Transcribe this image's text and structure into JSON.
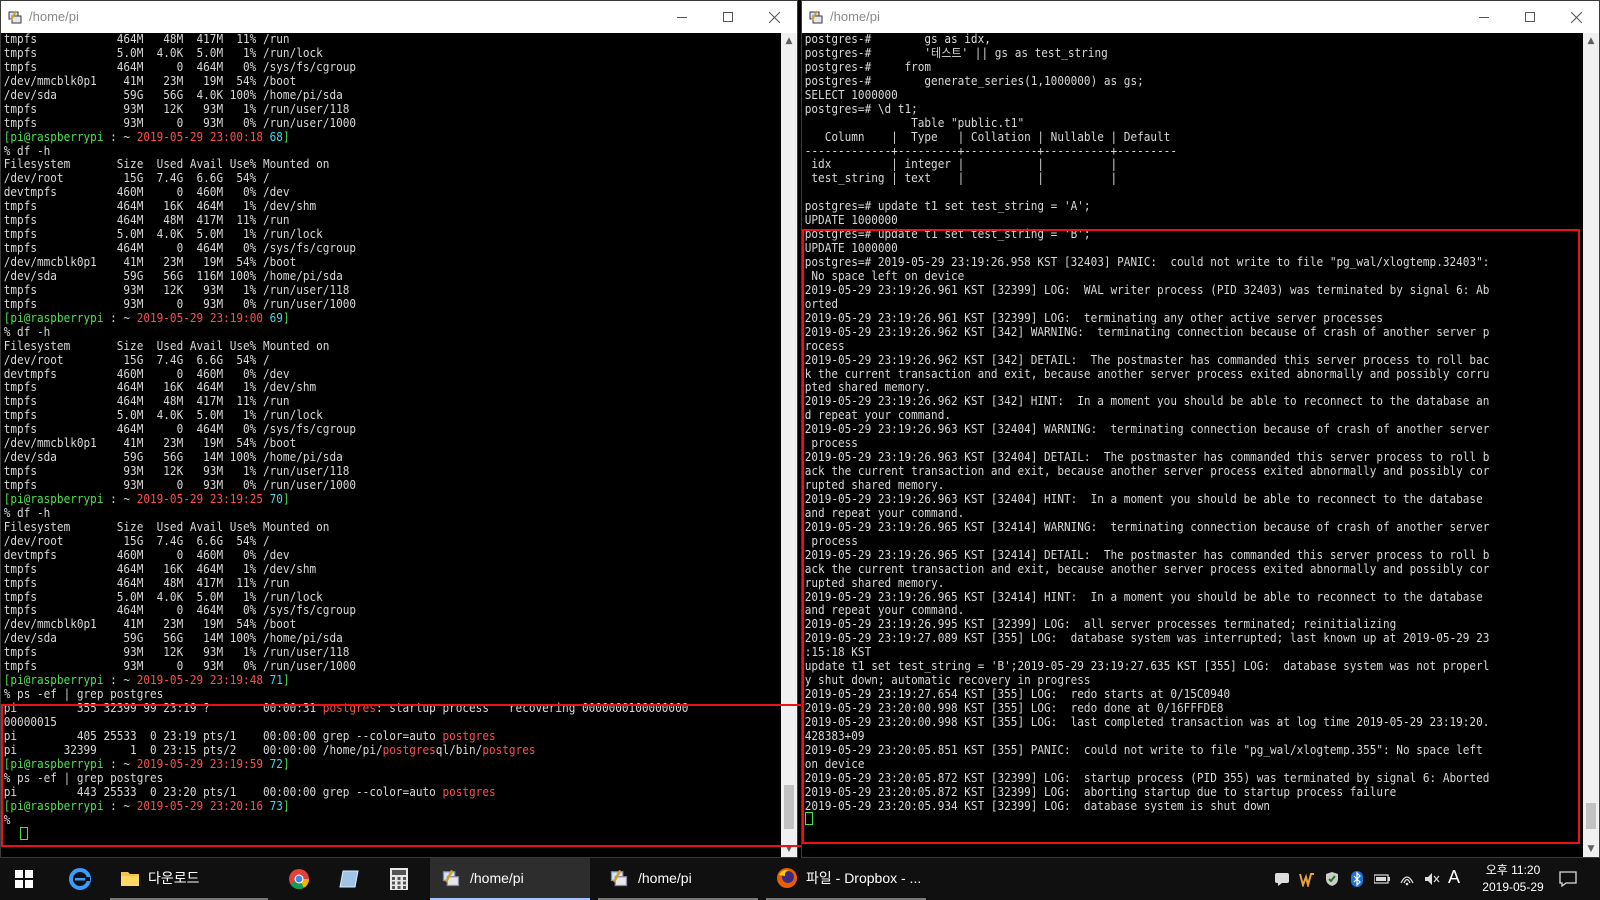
{
  "left_window": {
    "title": "/home/pi",
    "lines": [
      [
        {
          "t": "tmpfs            464M   48M  417M  11% /run"
        }
      ],
      [
        {
          "t": "tmpfs            5.0M  4.0K  5.0M   1% /run/lock"
        }
      ],
      [
        {
          "t": "tmpfs            464M     0  464M   0% /sys/fs/cgroup"
        }
      ],
      [
        {
          "t": "/dev/mmcblk0p1    41M   23M   19M  54% /boot"
        }
      ],
      [
        {
          "t": "/dev/sda          59G   56G  4.0K 100% /home/pi/sda"
        }
      ],
      [
        {
          "t": "tmpfs             93M   12K   93M   1% /run/user/118"
        }
      ],
      [
        {
          "t": "tmpfs             93M     0   93M   0% /run/user/1000"
        }
      ],
      [
        {
          "t": "[pi@raspberrypi",
          "c": "green"
        },
        {
          "t": " : ~ "
        },
        {
          "t": "2019-05-29 23:00:18",
          "c": "red"
        },
        {
          "t": " "
        },
        {
          "t": "68",
          "c": "cyan"
        },
        {
          "t": "]",
          "c": "green"
        }
      ],
      [
        {
          "t": "% df -h"
        }
      ],
      [
        {
          "t": "Filesystem       Size  Used Avail Use% Mounted on"
        }
      ],
      [
        {
          "t": "/dev/root         15G  7.4G  6.6G  54% /"
        }
      ],
      [
        {
          "t": "devtmpfs         460M     0  460M   0% /dev"
        }
      ],
      [
        {
          "t": "tmpfs            464M   16K  464M   1% /dev/shm"
        }
      ],
      [
        {
          "t": "tmpfs            464M   48M  417M  11% /run"
        }
      ],
      [
        {
          "t": "tmpfs            5.0M  4.0K  5.0M   1% /run/lock"
        }
      ],
      [
        {
          "t": "tmpfs            464M     0  464M   0% /sys/fs/cgroup"
        }
      ],
      [
        {
          "t": "/dev/mmcblk0p1    41M   23M   19M  54% /boot"
        }
      ],
      [
        {
          "t": "/dev/sda          59G   56G  116M 100% /home/pi/sda"
        }
      ],
      [
        {
          "t": "tmpfs             93M   12K   93M   1% /run/user/118"
        }
      ],
      [
        {
          "t": "tmpfs             93M     0   93M   0% /run/user/1000"
        }
      ],
      [
        {
          "t": "[pi@raspberrypi",
          "c": "green"
        },
        {
          "t": " : ~ "
        },
        {
          "t": "2019-05-29 23:19:00",
          "c": "red"
        },
        {
          "t": " "
        },
        {
          "t": "69",
          "c": "cyan"
        },
        {
          "t": "]",
          "c": "green"
        }
      ],
      [
        {
          "t": "% df -h"
        }
      ],
      [
        {
          "t": "Filesystem       Size  Used Avail Use% Mounted on"
        }
      ],
      [
        {
          "t": "/dev/root         15G  7.4G  6.6G  54% /"
        }
      ],
      [
        {
          "t": "devtmpfs         460M     0  460M   0% /dev"
        }
      ],
      [
        {
          "t": "tmpfs            464M   16K  464M   1% /dev/shm"
        }
      ],
      [
        {
          "t": "tmpfs            464M   48M  417M  11% /run"
        }
      ],
      [
        {
          "t": "tmpfs            5.0M  4.0K  5.0M   1% /run/lock"
        }
      ],
      [
        {
          "t": "tmpfs            464M     0  464M   0% /sys/fs/cgroup"
        }
      ],
      [
        {
          "t": "/dev/mmcblk0p1    41M   23M   19M  54% /boot"
        }
      ],
      [
        {
          "t": "/dev/sda          59G   56G   14M 100% /home/pi/sda"
        }
      ],
      [
        {
          "t": "tmpfs             93M   12K   93M   1% /run/user/118"
        }
      ],
      [
        {
          "t": "tmpfs             93M     0   93M   0% /run/user/1000"
        }
      ],
      [
        {
          "t": "[pi@raspberrypi",
          "c": "green"
        },
        {
          "t": " : ~ "
        },
        {
          "t": "2019-05-29 23:19:25",
          "c": "red"
        },
        {
          "t": " "
        },
        {
          "t": "70",
          "c": "cyan"
        },
        {
          "t": "]",
          "c": "green"
        }
      ],
      [
        {
          "t": "% df -h"
        }
      ],
      [
        {
          "t": "Filesystem       Size  Used Avail Use% Mounted on"
        }
      ],
      [
        {
          "t": "/dev/root         15G  7.4G  6.6G  54% /"
        }
      ],
      [
        {
          "t": "devtmpfs         460M     0  460M   0% /dev"
        }
      ],
      [
        {
          "t": "tmpfs            464M   16K  464M   1% /dev/shm"
        }
      ],
      [
        {
          "t": "tmpfs            464M   48M  417M  11% /run"
        }
      ],
      [
        {
          "t": "tmpfs            5.0M  4.0K  5.0M   1% /run/lock"
        }
      ],
      [
        {
          "t": "tmpfs            464M     0  464M   0% /sys/fs/cgroup"
        }
      ],
      [
        {
          "t": "/dev/mmcblk0p1    41M   23M   19M  54% /boot"
        }
      ],
      [
        {
          "t": "/dev/sda          59G   56G   14M 100% /home/pi/sda"
        }
      ],
      [
        {
          "t": "tmpfs             93M   12K   93M   1% /run/user/118"
        }
      ],
      [
        {
          "t": "tmpfs             93M     0   93M   0% /run/user/1000"
        }
      ],
      [
        {
          "t": "[pi@raspberrypi",
          "c": "green"
        },
        {
          "t": " : ~ "
        },
        {
          "t": "2019-05-29 23:19:48",
          "c": "red"
        },
        {
          "t": " "
        },
        {
          "t": "71",
          "c": "cyan"
        },
        {
          "t": "]",
          "c": "green"
        }
      ],
      [
        {
          "t": "% ps -ef | grep postgres"
        }
      ],
      [
        {
          "t": "pi         355 32399 99 23:19 ?        00:00:31 "
        },
        {
          "t": "postgres",
          "c": "red"
        },
        {
          "t": ": startup process   recovering 0000000100000000"
        }
      ],
      [
        {
          "t": "00000015"
        }
      ],
      [
        {
          "t": "pi         405 25533  0 23:19 pts/1    00:00:00 grep --color=auto "
        },
        {
          "t": "postgres",
          "c": "red"
        }
      ],
      [
        {
          "t": "pi       32399     1  0 23:15 pts/2    00:00:00 /home/pi/"
        },
        {
          "t": "postgres",
          "c": "red"
        },
        {
          "t": "ql/bin/"
        },
        {
          "t": "postgres",
          "c": "red"
        }
      ],
      [
        {
          "t": "[pi@raspberrypi",
          "c": "green"
        },
        {
          "t": " : ~ "
        },
        {
          "t": "2019-05-29 23:19:59",
          "c": "red"
        },
        {
          "t": " "
        },
        {
          "t": "72",
          "c": "cyan"
        },
        {
          "t": "]",
          "c": "green"
        }
      ],
      [
        {
          "t": "% ps -ef | grep postgres"
        }
      ],
      [
        {
          "t": "pi         443 25533  0 23:20 pts/1    00:00:00 grep --color=auto "
        },
        {
          "t": "postgres",
          "c": "red"
        }
      ],
      [
        {
          "t": "[pi@raspberrypi",
          "c": "green"
        },
        {
          "t": " : ~ "
        },
        {
          "t": "2019-05-29 23:20:16",
          "c": "red"
        },
        {
          "t": " "
        },
        {
          "t": "73",
          "c": "cyan"
        },
        {
          "t": "]",
          "c": "green"
        }
      ],
      [
        {
          "t": "% "
        }
      ]
    ]
  },
  "right_window": {
    "title": "/home/pi",
    "lines": [
      [
        {
          "t": "postgres-#        gs as idx,"
        }
      ],
      [
        {
          "t": "postgres-#        '테스트' || gs as test_string"
        }
      ],
      [
        {
          "t": "postgres-#     from"
        }
      ],
      [
        {
          "t": "postgres-#        generate_series(1,1000000) as gs;"
        }
      ],
      [
        {
          "t": "SELECT 1000000"
        }
      ],
      [
        {
          "t": "postgres=# \\d t1;"
        }
      ],
      [
        {
          "t": "                Table \"public.t1\""
        }
      ],
      [
        {
          "t": "   Column    |  Type   | Collation | Nullable | Default"
        }
      ],
      [
        {
          "t": "-------------+---------+-----------+----------+---------"
        }
      ],
      [
        {
          "t": " idx         | integer |           |          |"
        }
      ],
      [
        {
          "t": " test_string | text    |           |          |"
        }
      ],
      [
        {
          "t": ""
        }
      ],
      [
        {
          "t": "postgres=# update t1 set test_string = 'A';"
        }
      ],
      [
        {
          "t": "UPDATE 1000000"
        }
      ],
      [
        {
          "t": "postgres=# update t1 set test_string = 'B';"
        }
      ],
      [
        {
          "t": "UPDATE 1000000"
        }
      ],
      [
        {
          "t": "postgres=# 2019-05-29 23:19:26.958 KST [32403] PANIC:  could not write to file \"pg_wal/xlogtemp.32403\":"
        }
      ],
      [
        {
          "t": " No space left on device"
        }
      ],
      [
        {
          "t": "2019-05-29 23:19:26.961 KST [32399] LOG:  WAL writer process (PID 32403) was terminated by signal 6: Ab"
        }
      ],
      [
        {
          "t": "orted"
        }
      ],
      [
        {
          "t": "2019-05-29 23:19:26.961 KST [32399] LOG:  terminating any other active server processes"
        }
      ],
      [
        {
          "t": "2019-05-29 23:19:26.962 KST [342] WARNING:  terminating connection because of crash of another server p"
        }
      ],
      [
        {
          "t": "rocess"
        }
      ],
      [
        {
          "t": "2019-05-29 23:19:26.962 KST [342] DETAIL:  The postmaster has commanded this server process to roll bac"
        }
      ],
      [
        {
          "t": "k the current transaction and exit, because another server process exited abnormally and possibly corru"
        }
      ],
      [
        {
          "t": "pted shared memory."
        }
      ],
      [
        {
          "t": "2019-05-29 23:19:26.962 KST [342] HINT:  In a moment you should be able to reconnect to the database an"
        }
      ],
      [
        {
          "t": "d repeat your command."
        }
      ],
      [
        {
          "t": "2019-05-29 23:19:26.963 KST [32404] WARNING:  terminating connection because of crash of another server"
        }
      ],
      [
        {
          "t": " process"
        }
      ],
      [
        {
          "t": "2019-05-29 23:19:26.963 KST [32404] DETAIL:  The postmaster has commanded this server process to roll b"
        }
      ],
      [
        {
          "t": "ack the current transaction and exit, because another server process exited abnormally and possibly cor"
        }
      ],
      [
        {
          "t": "rupted shared memory."
        }
      ],
      [
        {
          "t": "2019-05-29 23:19:26.963 KST [32404] HINT:  In a moment you should be able to reconnect to the database"
        }
      ],
      [
        {
          "t": "and repeat your command."
        }
      ],
      [
        {
          "t": "2019-05-29 23:19:26.965 KST [32414] WARNING:  terminating connection because of crash of another server"
        }
      ],
      [
        {
          "t": " process"
        }
      ],
      [
        {
          "t": "2019-05-29 23:19:26.965 KST [32414] DETAIL:  The postmaster has commanded this server process to roll b"
        }
      ],
      [
        {
          "t": "ack the current transaction and exit, because another server process exited abnormally and possibly cor"
        }
      ],
      [
        {
          "t": "rupted shared memory."
        }
      ],
      [
        {
          "t": "2019-05-29 23:19:26.965 KST [32414] HINT:  In a moment you should be able to reconnect to the database"
        }
      ],
      [
        {
          "t": "and repeat your command."
        }
      ],
      [
        {
          "t": "2019-05-29 23:19:26.995 KST [32399] LOG:  all server processes terminated; reinitializing"
        }
      ],
      [
        {
          "t": "2019-05-29 23:19:27.089 KST [355] LOG:  database system was interrupted; last known up at 2019-05-29 23"
        }
      ],
      [
        {
          "t": ":15:18 KST"
        }
      ],
      [
        {
          "t": "update t1 set test_string = 'B';2019-05-29 23:19:27.635 KST [355] LOG:  database system was not properl"
        }
      ],
      [
        {
          "t": "y shut down; automatic recovery in progress"
        }
      ],
      [
        {
          "t": "2019-05-29 23:19:27.654 KST [355] LOG:  redo starts at 0/15C0940"
        }
      ],
      [
        {
          "t": "2019-05-29 23:20:00.998 KST [355] LOG:  redo done at 0/16FFFDE8"
        }
      ],
      [
        {
          "t": "2019-05-29 23:20:00.998 KST [355] LOG:  last completed transaction was at log time 2019-05-29 23:19:20."
        }
      ],
      [
        {
          "t": "428383+09"
        }
      ],
      [
        {
          "t": "2019-05-29 23:20:05.851 KST [355] PANIC:  could not write to file \"pg_wal/xlogtemp.355\": No space left"
        }
      ],
      [
        {
          "t": "on device"
        }
      ],
      [
        {
          "t": "2019-05-29 23:20:05.872 KST [32399] LOG:  startup process (PID 355) was terminated by signal 6: Aborted"
        }
      ],
      [
        {
          "t": "2019-05-29 23:20:05.872 KST [32399] LOG:  aborting startup due to startup process failure"
        }
      ],
      [
        {
          "t": "2019-05-29 23:20:05.934 KST [32399] LOG:  database system is shut down"
        }
      ],
      [
        {
          "t": ""
        }
      ]
    ]
  },
  "taskbar": {
    "items": [
      {
        "name": "taskbar-file-explorer",
        "label": "다운로드",
        "icon": "folder-icon"
      },
      {
        "name": "taskbar-terminal-1",
        "label": "/home/pi",
        "icon": "terminal-icon"
      },
      {
        "name": "taskbar-terminal-2",
        "label": "/home/pi",
        "icon": "terminal-icon"
      },
      {
        "name": "taskbar-firefox",
        "label": "파일 - Dropbox - ...",
        "icon": "firefox-icon"
      }
    ],
    "ime_label": "A",
    "clock_time": "오후 11:20",
    "clock_date": "2019-05-29"
  },
  "colors": {
    "prompt_green": "#4ee04e",
    "timestamp_red": "#ff4d4d",
    "counter_cyan": "#46d9e6",
    "highlight_red": "#ee1111"
  }
}
